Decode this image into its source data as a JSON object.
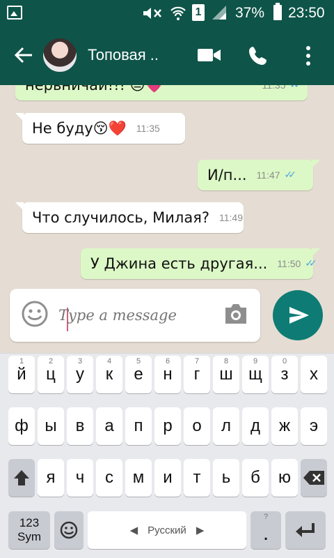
{
  "status_bar": {
    "battery_percent": "37%",
    "time": "23:50",
    "sim_slot": "1"
  },
  "header": {
    "contact_name": "Топовая ..",
    "icons": [
      "back-arrow-icon",
      "avatar",
      "video-call-icon",
      "phone-icon",
      "more-vert-icon"
    ]
  },
  "messages": [
    {
      "direction": "out",
      "text": "нервничай!!! 😑💗",
      "time": "11:35",
      "read": true
    },
    {
      "direction": "in",
      "text": "Не буду😚❤️",
      "time": "11:35"
    },
    {
      "direction": "out",
      "text": "И/п...",
      "time": "11:47",
      "read": true
    },
    {
      "direction": "in",
      "text": "Что случилось, Милая?",
      "time": "11:49"
    },
    {
      "direction": "out",
      "text": "У Джина есть другая...",
      "time": "11:50",
      "read": true
    }
  ],
  "composer": {
    "placeholder": "Type a message"
  },
  "keyboard": {
    "row1": {
      "keys": [
        "й",
        "ц",
        "у",
        "к",
        "е",
        "н",
        "г",
        "ш",
        "щ",
        "з",
        "х"
      ],
      "hints": [
        "1",
        "2",
        "3",
        "4",
        "5",
        "6",
        "7",
        "8",
        "9",
        "0",
        ""
      ]
    },
    "row2": [
      "ф",
      "ы",
      "в",
      "а",
      "п",
      "р",
      "о",
      "л",
      "д",
      "ж",
      "э"
    ],
    "row3": [
      "я",
      "ч",
      "с",
      "м",
      "и",
      "т",
      "ь",
      "б",
      "ю"
    ],
    "sym_label_top": "123",
    "sym_label_bottom": "Sym",
    "space_label": "Русский",
    "period": ".",
    "period_hint": "?"
  },
  "colors": {
    "header": "#0e5449",
    "outgoing_bubble": "#dcf8c6",
    "incoming_bubble": "#ffffff",
    "send_button": "#0e7c74",
    "read_ticks": "#4fa3e0"
  }
}
